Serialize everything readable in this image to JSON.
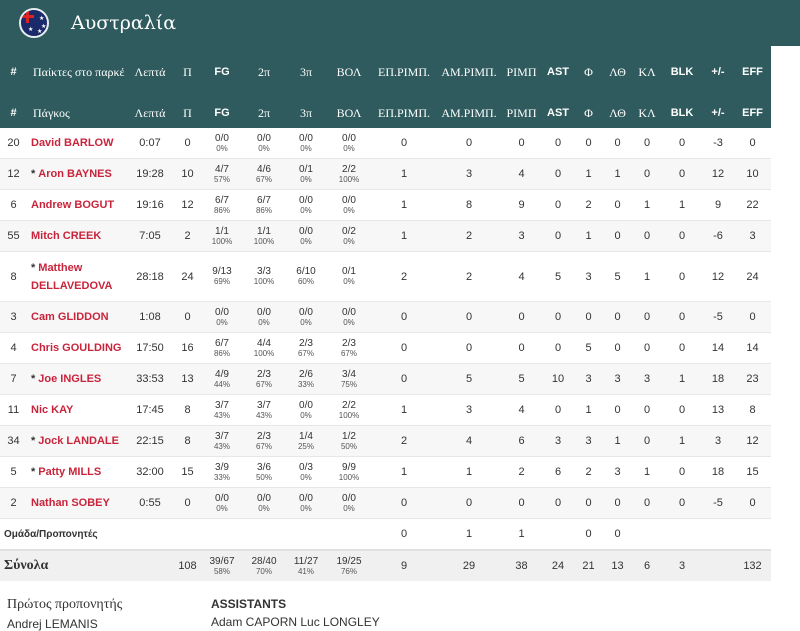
{
  "team": {
    "name": "Αυστραλία"
  },
  "columns": {
    "num": "#",
    "on_court": "Παίκτες στο παρκέ",
    "bench": "Πάγκος",
    "min": "Λεπτά",
    "pts": "Π",
    "fg": "FG",
    "p2": "2π",
    "p3": "3π",
    "ft": "ΒΟΛ",
    "oreb": "ΕΠ.ΡΙΜΠ.",
    "dreb": "ΑΜ.ΡΙΜΠ.",
    "reb": "ΡΙΜΠ",
    "ast": "AST",
    "pf": "Φ",
    "to": "ΛΘ",
    "stl": "ΚΛ",
    "blk": "BLK",
    "pm": "+/-",
    "eff": "EFF"
  },
  "players": [
    {
      "no": "20",
      "starter": "",
      "name": "David BARLOW",
      "min": "0:07",
      "pts": "0",
      "fg": "0/0",
      "fg_pct": "0%",
      "p2": "0/0",
      "p2_pct": "0%",
      "p3": "0/0",
      "p3_pct": "0%",
      "ft": "0/0",
      "ft_pct": "0%",
      "oreb": "0",
      "dreb": "0",
      "reb": "0",
      "ast": "0",
      "pf": "0",
      "to": "0",
      "stl": "0",
      "blk": "0",
      "pm": "-3",
      "eff": "0"
    },
    {
      "no": "12",
      "starter": "*",
      "name": "Aron BAYNES",
      "min": "19:28",
      "pts": "10",
      "fg": "4/7",
      "fg_pct": "57%",
      "p2": "4/6",
      "p2_pct": "67%",
      "p3": "0/1",
      "p3_pct": "0%",
      "ft": "2/2",
      "ft_pct": "100%",
      "oreb": "1",
      "dreb": "3",
      "reb": "4",
      "ast": "0",
      "pf": "1",
      "to": "1",
      "stl": "0",
      "blk": "0",
      "pm": "12",
      "eff": "10"
    },
    {
      "no": "6",
      "starter": "",
      "name": "Andrew BOGUT",
      "min": "19:16",
      "pts": "12",
      "fg": "6/7",
      "fg_pct": "86%",
      "p2": "6/7",
      "p2_pct": "86%",
      "p3": "0/0",
      "p3_pct": "0%",
      "ft": "0/0",
      "ft_pct": "0%",
      "oreb": "1",
      "dreb": "8",
      "reb": "9",
      "ast": "0",
      "pf": "2",
      "to": "0",
      "stl": "1",
      "blk": "1",
      "pm": "9",
      "eff": "22"
    },
    {
      "no": "55",
      "starter": "",
      "name": "Mitch CREEK",
      "min": "7:05",
      "pts": "2",
      "fg": "1/1",
      "fg_pct": "100%",
      "p2": "1/1",
      "p2_pct": "100%",
      "p3": "0/0",
      "p3_pct": "0%",
      "ft": "0/2",
      "ft_pct": "0%",
      "oreb": "1",
      "dreb": "2",
      "reb": "3",
      "ast": "0",
      "pf": "1",
      "to": "0",
      "stl": "0",
      "blk": "0",
      "pm": "-6",
      "eff": "3"
    },
    {
      "no": "8",
      "starter": "*",
      "name": "Matthew DELLAVEDOVA",
      "min": "28:18",
      "pts": "24",
      "fg": "9/13",
      "fg_pct": "69%",
      "p2": "3/3",
      "p2_pct": "100%",
      "p3": "6/10",
      "p3_pct": "60%",
      "ft": "0/1",
      "ft_pct": "0%",
      "oreb": "2",
      "dreb": "2",
      "reb": "4",
      "ast": "5",
      "pf": "3",
      "to": "5",
      "stl": "1",
      "blk": "0",
      "pm": "12",
      "eff": "24"
    },
    {
      "no": "3",
      "starter": "",
      "name": "Cam GLIDDON",
      "min": "1:08",
      "pts": "0",
      "fg": "0/0",
      "fg_pct": "0%",
      "p2": "0/0",
      "p2_pct": "0%",
      "p3": "0/0",
      "p3_pct": "0%",
      "ft": "0/0",
      "ft_pct": "0%",
      "oreb": "0",
      "dreb": "0",
      "reb": "0",
      "ast": "0",
      "pf": "0",
      "to": "0",
      "stl": "0",
      "blk": "0",
      "pm": "-5",
      "eff": "0"
    },
    {
      "no": "4",
      "starter": "",
      "name": "Chris GOULDING",
      "min": "17:50",
      "pts": "16",
      "fg": "6/7",
      "fg_pct": "86%",
      "p2": "4/4",
      "p2_pct": "100%",
      "p3": "2/3",
      "p3_pct": "67%",
      "ft": "2/3",
      "ft_pct": "67%",
      "oreb": "0",
      "dreb": "0",
      "reb": "0",
      "ast": "0",
      "pf": "5",
      "to": "0",
      "stl": "0",
      "blk": "0",
      "pm": "14",
      "eff": "14"
    },
    {
      "no": "7",
      "starter": "*",
      "name": "Joe INGLES",
      "min": "33:53",
      "pts": "13",
      "fg": "4/9",
      "fg_pct": "44%",
      "p2": "2/3",
      "p2_pct": "67%",
      "p3": "2/6",
      "p3_pct": "33%",
      "ft": "3/4",
      "ft_pct": "75%",
      "oreb": "0",
      "dreb": "5",
      "reb": "5",
      "ast": "10",
      "pf": "3",
      "to": "3",
      "stl": "3",
      "blk": "1",
      "pm": "18",
      "eff": "23"
    },
    {
      "no": "11",
      "starter": "",
      "name": "Nic KAY",
      "min": "17:45",
      "pts": "8",
      "fg": "3/7",
      "fg_pct": "43%",
      "p2": "3/7",
      "p2_pct": "43%",
      "p3": "0/0",
      "p3_pct": "0%",
      "ft": "2/2",
      "ft_pct": "100%",
      "oreb": "1",
      "dreb": "3",
      "reb": "4",
      "ast": "0",
      "pf": "1",
      "to": "0",
      "stl": "0",
      "blk": "0",
      "pm": "13",
      "eff": "8"
    },
    {
      "no": "34",
      "starter": "*",
      "name": "Jock LANDALE",
      "min": "22:15",
      "pts": "8",
      "fg": "3/7",
      "fg_pct": "43%",
      "p2": "2/3",
      "p2_pct": "67%",
      "p3": "1/4",
      "p3_pct": "25%",
      "ft": "1/2",
      "ft_pct": "50%",
      "oreb": "2",
      "dreb": "4",
      "reb": "6",
      "ast": "3",
      "pf": "3",
      "to": "1",
      "stl": "0",
      "blk": "1",
      "pm": "3",
      "eff": "12"
    },
    {
      "no": "5",
      "starter": "*",
      "name": "Patty MILLS",
      "min": "32:00",
      "pts": "15",
      "fg": "3/9",
      "fg_pct": "33%",
      "p2": "3/6",
      "p2_pct": "50%",
      "p3": "0/3",
      "p3_pct": "0%",
      "ft": "9/9",
      "ft_pct": "100%",
      "oreb": "1",
      "dreb": "1",
      "reb": "2",
      "ast": "6",
      "pf": "2",
      "to": "3",
      "stl": "1",
      "blk": "0",
      "pm": "18",
      "eff": "15"
    },
    {
      "no": "2",
      "starter": "",
      "name": "Nathan SOBEY",
      "min": "0:55",
      "pts": "0",
      "fg": "0/0",
      "fg_pct": "0%",
      "p2": "0/0",
      "p2_pct": "0%",
      "p3": "0/0",
      "p3_pct": "0%",
      "ft": "0/0",
      "ft_pct": "0%",
      "oreb": "0",
      "dreb": "0",
      "reb": "0",
      "ast": "0",
      "pf": "0",
      "to": "0",
      "stl": "0",
      "blk": "0",
      "pm": "-5",
      "eff": "0"
    }
  ],
  "team_row": {
    "label": "Ομάδα/Προπονητές",
    "oreb": "0",
    "dreb": "1",
    "reb": "1",
    "pf": "0",
    "to": "0"
  },
  "totals": {
    "label": "Σύνολα",
    "pts": "108",
    "fg": "39/67",
    "fg_pct": "58%",
    "p2": "28/40",
    "p2_pct": "70%",
    "p3": "11/27",
    "p3_pct": "41%",
    "ft": "19/25",
    "ft_pct": "76%",
    "oreb": "9",
    "dreb": "29",
    "reb": "38",
    "ast": "24",
    "pf": "21",
    "to": "13",
    "stl": "6",
    "blk": "3",
    "eff": "132"
  },
  "coaches": {
    "head_label": "Πρώτος προπονητής",
    "head_name": "Andrej LEMANIS",
    "assistants_label": "ASSISTANTS",
    "assistants_names": "Adam CAPORN Luc LONGLEY"
  },
  "colors": {
    "header_bg": "#2f5b5e",
    "player_name": "#c8243b"
  }
}
